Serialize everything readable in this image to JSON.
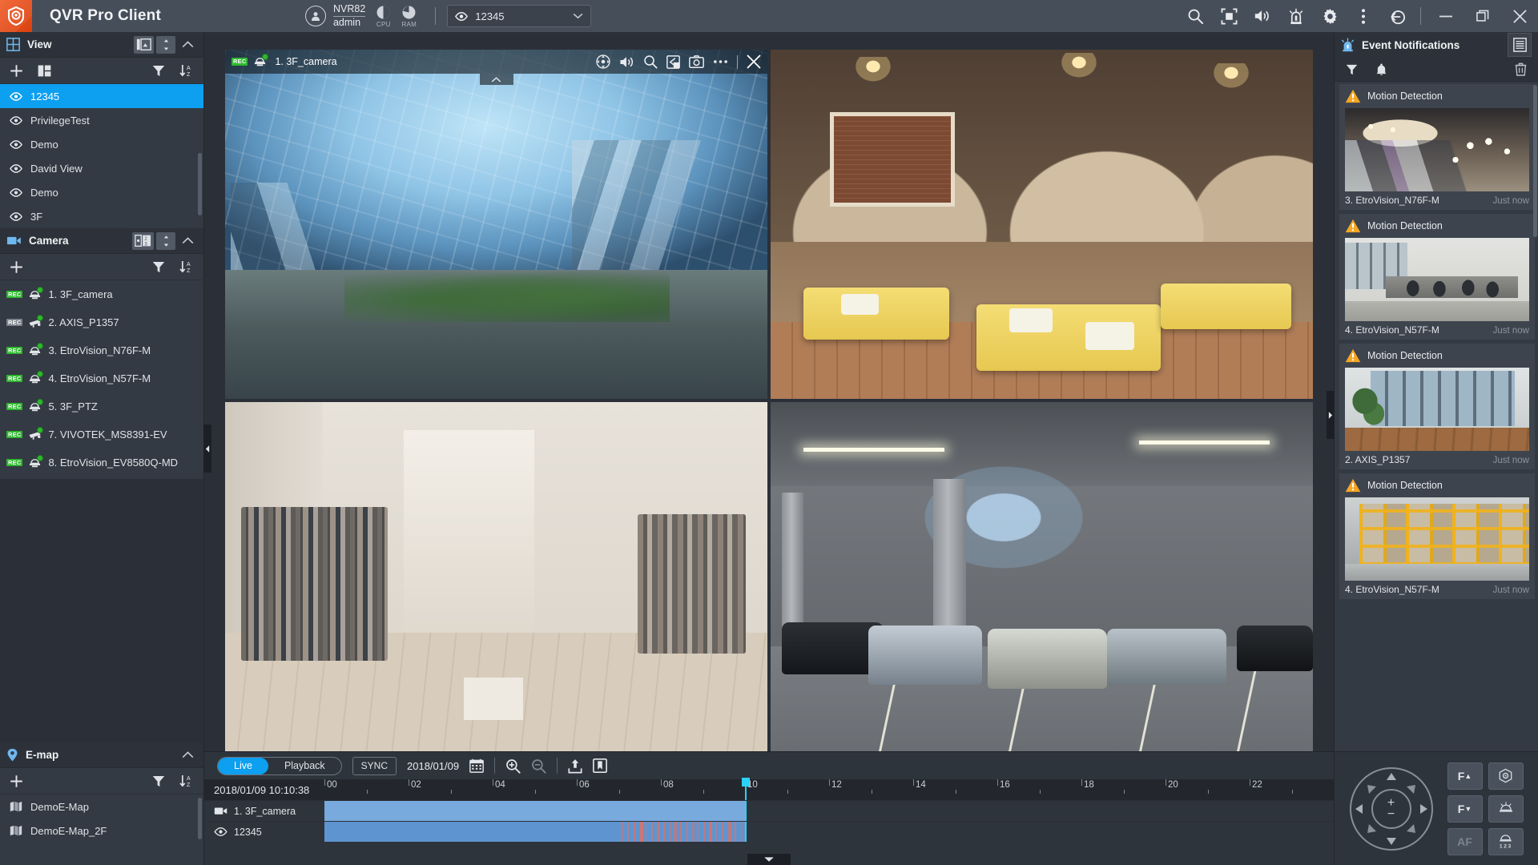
{
  "app": {
    "title": "QVR Pro Client",
    "logo_icon": "qvr-camera-shield-logo"
  },
  "titlebar": {
    "user": {
      "server": "NVR82",
      "account": "admin"
    },
    "meters": [
      {
        "label": "CPU",
        "icon": "cpu-gauge-icon"
      },
      {
        "label": "RAM",
        "icon": "ram-gauge-icon"
      }
    ],
    "view_selector": {
      "value": "12345",
      "icon": "eye-icon",
      "chevron": "chevron-down-icon"
    },
    "tools": [
      {
        "name": "search-icon",
        "label": "Search"
      },
      {
        "name": "fullscreen-icon",
        "label": "Full Screen"
      },
      {
        "name": "speaker-icon",
        "label": "Audio"
      },
      {
        "name": "alarm-icon",
        "label": "Alarm"
      },
      {
        "name": "gear-icon",
        "label": "Settings"
      },
      {
        "name": "more-vertical-icon",
        "label": "More"
      },
      {
        "name": "logout-icon",
        "label": "Log Out"
      }
    ],
    "window_controls": [
      {
        "name": "minimize-icon",
        "label": "Minimize"
      },
      {
        "name": "restore-icon",
        "label": "Restore"
      },
      {
        "name": "close-icon",
        "label": "Close"
      }
    ]
  },
  "sidebar": {
    "view": {
      "title": "View",
      "icon": "grid-icon",
      "header_buttons": [
        {
          "name": "layout-toggle-button",
          "icon": "view-layout-icon"
        },
        {
          "name": "view-updown-button",
          "icon": "up-down-arrows-icon"
        },
        {
          "name": "collapse-view-button",
          "icon": "chevron-up-icon"
        }
      ],
      "tools": [
        {
          "name": "add-view-button",
          "icon": "plus-icon"
        },
        {
          "name": "layout-grid-button",
          "icon": "panel-layout-icon"
        },
        {
          "name": "filter-views-button",
          "icon": "filter-icon"
        },
        {
          "name": "sort-views-button",
          "icon": "sort-icon"
        }
      ],
      "items": [
        {
          "label": "12345",
          "icon": "eye-icon",
          "selected": true
        },
        {
          "label": "PrivilegeTest",
          "icon": "eye-icon",
          "selected": false
        },
        {
          "label": "Demo",
          "icon": "eye-icon",
          "selected": false
        },
        {
          "label": "David View",
          "icon": "eye-icon",
          "selected": false
        },
        {
          "label": "Demo",
          "icon": "eye-icon",
          "selected": false
        },
        {
          "label": "3F",
          "icon": "eye-icon",
          "selected": false
        }
      ]
    },
    "camera": {
      "title": "Camera",
      "icon": "video-camera-icon",
      "header_buttons": [
        {
          "name": "camera-layout-button",
          "icon": "camera-list-icon"
        },
        {
          "name": "camera-updown-button",
          "icon": "up-down-arrows-icon"
        },
        {
          "name": "collapse-camera-button",
          "icon": "chevron-up-icon"
        }
      ],
      "tools": [
        {
          "name": "add-camera-button",
          "icon": "plus-icon"
        },
        {
          "name": "filter-cameras-button",
          "icon": "filter-icon"
        },
        {
          "name": "sort-cameras-button",
          "icon": "sort-icon"
        }
      ],
      "rec_label": "REC",
      "items": [
        {
          "label": "1. 3F_camera",
          "recording": true,
          "type": "dome"
        },
        {
          "label": "2. AXIS_P1357",
          "recording": false,
          "type": "bullet"
        },
        {
          "label": "3. EtroVision_N76F-M",
          "recording": true,
          "type": "dome"
        },
        {
          "label": "4. EtroVision_N57F-M",
          "recording": true,
          "type": "dome"
        },
        {
          "label": "5. 3F_PTZ",
          "recording": true,
          "type": "dome"
        },
        {
          "label": "7. VIVOTEK_MS8391-EV",
          "recording": true,
          "type": "bullet"
        },
        {
          "label": "8. EtroVision_EV8580Q-MD",
          "recording": true,
          "type": "dome"
        }
      ]
    },
    "emap": {
      "title": "E-map",
      "icon": "map-pin-icon",
      "header_buttons": [
        {
          "name": "collapse-emap-button",
          "icon": "chevron-up-icon"
        }
      ],
      "tools": [
        {
          "name": "add-emap-button",
          "icon": "plus-icon"
        },
        {
          "name": "filter-emaps-button",
          "icon": "filter-icon"
        },
        {
          "name": "sort-emaps-button",
          "icon": "sort-icon"
        }
      ],
      "items": [
        {
          "label": "DemoE-Map",
          "icon": "map-icon"
        },
        {
          "label": "DemoE-Map_2F",
          "icon": "map-icon"
        }
      ]
    },
    "collapse_handle": {
      "name": "collapse-sidebar-handle",
      "icon": "chevron-left-icon"
    }
  },
  "video_grid": {
    "cells": [
      {
        "title": "1. 3F_camera",
        "rec_label": "REC",
        "recording": true,
        "active": true,
        "scene": "atrium",
        "tools": [
          {
            "name": "ptz-control-icon"
          },
          {
            "name": "speaker-icon"
          },
          {
            "name": "digital-zoom-icon"
          },
          {
            "name": "snapshot-sequence-icon"
          },
          {
            "name": "camera-snapshot-icon"
          },
          {
            "name": "more-horizontal-icon"
          },
          {
            "name": "close-icon"
          }
        ],
        "expand_chevron": "chevron-up-icon"
      },
      {
        "title": "",
        "scene": "restaurant",
        "active": false
      },
      {
        "title": "",
        "scene": "boutique",
        "active": false
      },
      {
        "title": "",
        "scene": "garage",
        "active": false
      }
    ],
    "collapse_handle": {
      "name": "collapse-timeline-handle",
      "icon": "chevron-down-icon"
    }
  },
  "timeline": {
    "mode_tabs": [
      {
        "label": "Live",
        "active": true
      },
      {
        "label": "Playback",
        "active": false
      }
    ],
    "sync_label": "SYNC",
    "date": "2018/01/09",
    "calendar_icon": "calendar-icon",
    "zoom_in_icon": "zoom-in-icon",
    "zoom_out_icon": "zoom-out-icon",
    "export_icon": "export-icon",
    "bookmark_icon": "bookmark-icon",
    "globe_icon": "globe-icon",
    "current_time": "2018/01/09 10:10:38",
    "hour_labels": [
      "00",
      "02",
      "04",
      "06",
      "08",
      "10",
      "12",
      "14",
      "16",
      "18",
      "20",
      "22"
    ],
    "playhead_hour": 10,
    "rows": [
      {
        "label": "1. 3F_camera",
        "icon": "video-camera-icon",
        "recorded_from": 0,
        "recorded_to": 10,
        "has_events": false
      },
      {
        "label": "12345",
        "icon": "eye-icon",
        "recorded_from": 0,
        "recorded_to": 10,
        "has_events": true
      }
    ]
  },
  "event_panel": {
    "title": "Event Notifications",
    "icon": "alarm-light-icon",
    "log_button": {
      "name": "event-log-button",
      "icon": "list-log-icon"
    },
    "tools": [
      {
        "name": "filter-events-button",
        "icon": "filter-icon"
      },
      {
        "name": "mute-events-button",
        "icon": "bell-icon"
      },
      {
        "name": "clear-events-button",
        "icon": "trash-icon"
      }
    ],
    "events": [
      {
        "type": "Motion Detection",
        "camera": "3. EtroVision_N76F-M",
        "time": "Just now",
        "thumb": "mall"
      },
      {
        "type": "Motion Detection",
        "camera": "4. EtroVision_N57F-M",
        "time": "Just now",
        "thumb": "office"
      },
      {
        "type": "Motion Detection",
        "camera": "2. AXIS_P1357",
        "time": "Just now",
        "thumb": "corridor"
      },
      {
        "type": "Motion Detection",
        "camera": "4. EtroVision_N57F-M",
        "time": "Just now",
        "thumb": "warehouse"
      }
    ],
    "collapse_handle": {
      "name": "collapse-event-panel-handle",
      "icon": "chevron-right-icon"
    }
  },
  "ptz": {
    "joystick": {
      "name": "ptz-joystick",
      "zoom_in_label": "+",
      "zoom_out_label": "−"
    },
    "buttons": [
      {
        "label": "F",
        "sub": "▲",
        "name": "focus-near-button",
        "disabled": false
      },
      {
        "label": "",
        "sub": "",
        "name": "ptz-target-button",
        "icon": "target-icon",
        "disabled": false
      },
      {
        "label": "F",
        "sub": "▼",
        "name": "focus-far-button",
        "disabled": false
      },
      {
        "label": "",
        "sub": "",
        "name": "ptz-home-button",
        "icon": "home-dome-icon",
        "disabled": false
      },
      {
        "label": "AF",
        "sub": "",
        "name": "auto-focus-button",
        "disabled": true
      },
      {
        "label": "",
        "sub": "",
        "name": "ptz-preset-button",
        "icon": "preset-123-icon",
        "disabled": false
      }
    ]
  },
  "colors": {
    "accent_blue": "#0d9ff0",
    "active_outline": "#d8c21f",
    "rec_green": "#2eb82e",
    "warning_orange": "#f5a623",
    "playhead_cyan": "#2ad2f5",
    "timeline_bar": "#78aadd",
    "logo_orange": "#e8511f"
  }
}
